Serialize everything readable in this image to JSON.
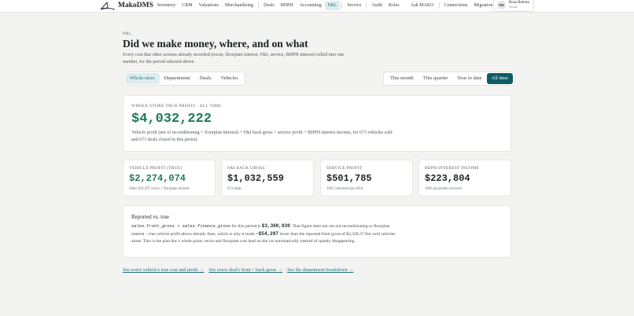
{
  "nav": {
    "brand": "MakoDMS",
    "items": [
      {
        "label": "Inventory",
        "active": false
      },
      {
        "label": "CRM",
        "active": false
      },
      {
        "label": "Valuations",
        "active": false
      },
      {
        "label": "Merchandising",
        "active": false
      },
      {
        "label": "Deals",
        "active": false
      },
      {
        "label": "BHPH",
        "active": false
      },
      {
        "label": "Accounting",
        "active": false
      },
      {
        "label": "P&L",
        "active": true
      },
      {
        "label": "Service",
        "active": false
      },
      {
        "label": "Audit",
        "active": false
      },
      {
        "label": "Roles",
        "active": false
      }
    ],
    "right_items": [
      "Ask MAKO",
      "Connections",
      "Migration"
    ],
    "user": {
      "initials": "RB",
      "name": "Rosa Beltran",
      "role": "Owner"
    }
  },
  "header": {
    "eyebrow": "P&L",
    "title": "Did we make money, where, and on what",
    "subtitle": "Every cost that other screens already recorded (recon, floorplan interest, F&I, service, BHPH interest) rolled into one number, for the period selected above."
  },
  "scope_tabs": [
    {
      "label": "Whole store",
      "active": true
    },
    {
      "label": "Departments",
      "active": false
    },
    {
      "label": "Deals",
      "active": false
    },
    {
      "label": "Vehicles",
      "active": false
    }
  ],
  "period_tabs": [
    {
      "label": "This month",
      "active": false
    },
    {
      "label": "This quarter",
      "active": false
    },
    {
      "label": "Year to date",
      "active": false
    },
    {
      "label": "All time",
      "active": true
    }
  ],
  "hero": {
    "label": "WHOLE STORE TRUE PROFIT · ALL TIME",
    "value": "$4,032,222",
    "description": "Vehicle profit (net of reconditioning + floorplan interest) + F&I back gross + service profit + BHPH interest income, for 673 vehicles sold and 673 deals closed in this period."
  },
  "stats": [
    {
      "label": "VEHICLE PROFIT (TRUE)",
      "value": "$2,274,074",
      "sub": "After $54,297 recon + floorplan interest"
    },
    {
      "label": "F&I BACK GROSS",
      "value": "$1,032,559",
      "sub": "673 deals"
    },
    {
      "label": "SERVICE PROFIT",
      "value": "$501,785",
      "sub": "1002 customer-pay ROs"
    },
    {
      "label": "BHPH INTEREST INCOME",
      "value": "$223,804",
      "sub": "1864 payments received"
    }
  ],
  "reported": {
    "title": "Reported vs. true",
    "code": "sales.front_gross + sales.finance_gross",
    "text1": " for this period is ",
    "amount1": "$3,360,930",
    "text2": ". That figure does not net out reconditioning or floorplan interest – true vehicle profit above already does, which is why it reads ",
    "amount2": "−$54,297",
    "text3": " lower than the reported front gross of $2,328,371for sold vehicles alone. This is the plan doc's whole point: recon and floorplan cost land on the car automatically instead of quietly disappearing."
  },
  "links": [
    "See every vehicle's true cost and profit →",
    "See every deal's front + back gross →",
    "See the department breakdown →"
  ],
  "colors": {
    "accent": "#0f5b66",
    "positive": "#1f7a55",
    "active_tab_bg": "#dcecef"
  }
}
